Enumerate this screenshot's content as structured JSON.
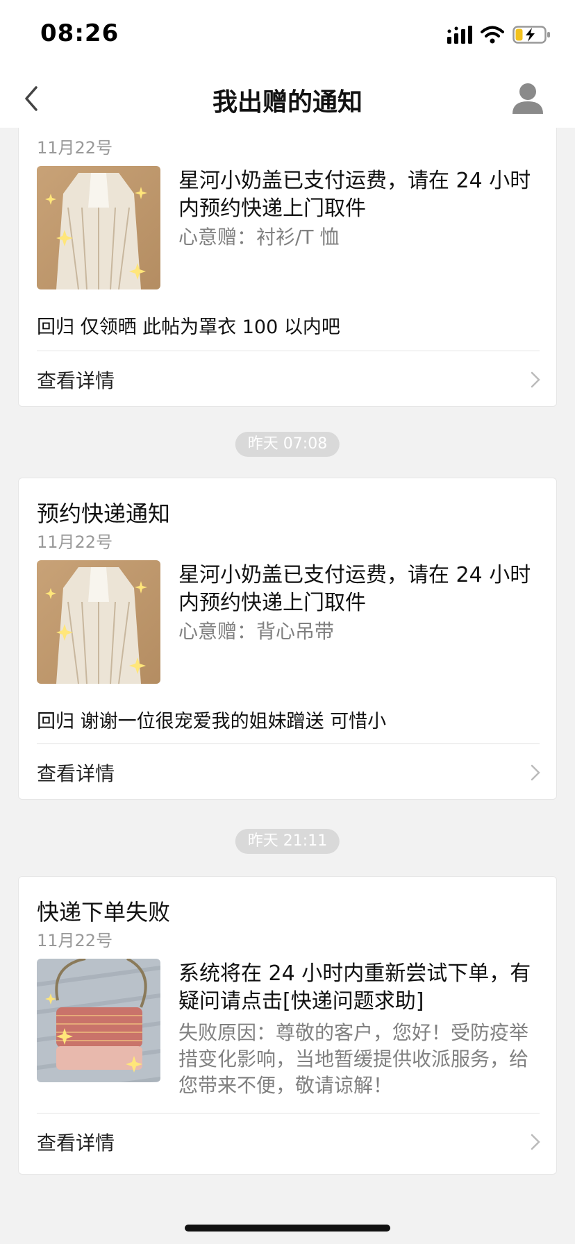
{
  "status_bar": {
    "time": "08:26"
  },
  "nav": {
    "title": "我出赠的通知"
  },
  "cards": [
    {
      "title": "",
      "date": "11月22号",
      "message": "星河小奶盖已支付运费，请在 24 小时内预约快递上门取件",
      "sub": "心意赠：衬衫/T 恤",
      "desc": "回归 仅领晒 此帖为罩衣 100 以内吧",
      "detail_label": "查看详情"
    },
    {
      "time_label": "昨天 07:08",
      "title": "预约快递通知",
      "date": "11月22号",
      "message": "星河小奶盖已支付运费，请在 24 小时内预约快递上门取件",
      "sub": "心意赠：背心吊带",
      "desc": "回归 谢谢一位很宠爱我的姐妹蹭送 可惜小",
      "detail_label": "查看详情"
    },
    {
      "time_label": "昨天 21:11",
      "title": "快递下单失败",
      "date": "11月22号",
      "message": "系统将在 24 小时内重新尝试下单，有疑问请点击[快递问题求助]",
      "sub": "失败原因：尊敬的客户，您好！受防疫举措变化影响，当地暂缓提供收派服务，给您带来不便，敬请谅解！",
      "detail_label": "查看详情"
    }
  ]
}
